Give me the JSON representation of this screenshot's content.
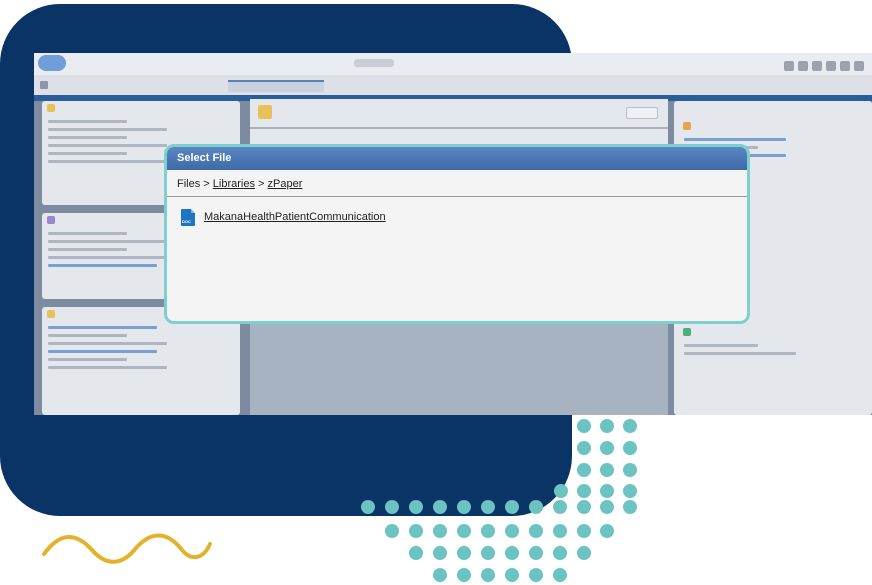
{
  "modal": {
    "title": "Select File",
    "breadcrumb": [
      "Files",
      "Libraries",
      "zPaper"
    ],
    "breadcrumb_separator": ">",
    "files": [
      {
        "name": "MakanaHealthPatientCommunication",
        "icon": "doc-file-icon",
        "icon_label": "DOC"
      }
    ]
  },
  "colors": {
    "navy_backdrop": "#0b3466",
    "teal_dots": "#6cc4c2",
    "gold_squiggle": "#e3b22a",
    "modal_border": "#7cd0cf",
    "modal_titlebar": "#4a76b5"
  }
}
